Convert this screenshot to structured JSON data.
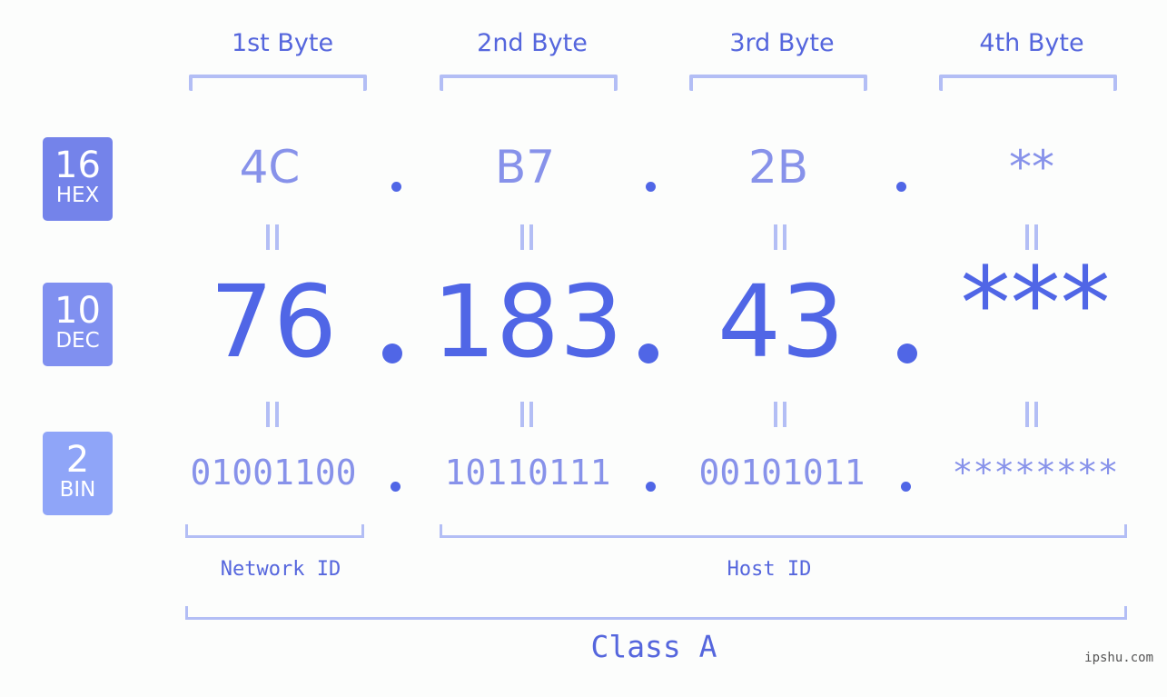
{
  "bytes": [
    {
      "label": "1st Byte",
      "hex": "4C",
      "dec": "76",
      "bin": "01001100"
    },
    {
      "label": "2nd Byte",
      "hex": "B7",
      "dec": "183",
      "bin": "10110111"
    },
    {
      "label": "3rd Byte",
      "hex": "2B",
      "dec": "43",
      "bin": "00101011"
    },
    {
      "label": "4th Byte",
      "hex": "**",
      "dec": "***",
      "bin": "********"
    }
  ],
  "separator": ".",
  "badges": {
    "hex": {
      "num": "16",
      "label": "HEX",
      "color": "#7483ea"
    },
    "dec": {
      "num": "10",
      "label": "DEC",
      "color": "#8090f0"
    },
    "bin": {
      "num": "2",
      "label": "BIN",
      "color": "#8fa5f8"
    }
  },
  "network_id_label": "Network ID",
  "host_id_label": "Host ID",
  "class_label": "Class A",
  "watermark": "ipshu.com",
  "colors": {
    "accent": "#5066e6",
    "light": "#8792ea",
    "bracket": "#b3bef5"
  }
}
